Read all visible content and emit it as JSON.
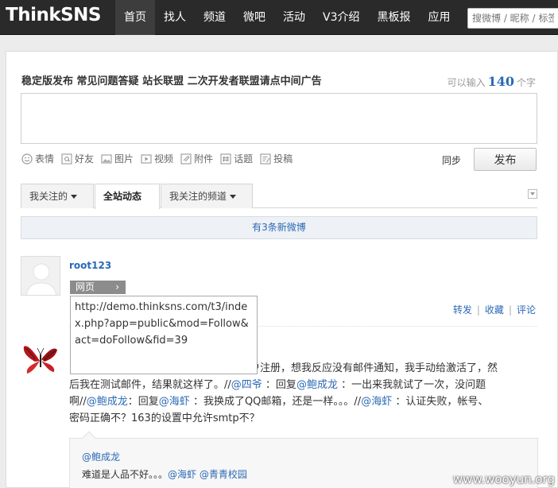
{
  "header": {
    "logo": "ThinkSNS",
    "nav": [
      {
        "label": "首页",
        "active": true
      },
      {
        "label": "找人"
      },
      {
        "label": "频道"
      },
      {
        "label": "微吧"
      },
      {
        "label": "活动"
      },
      {
        "label": "V3介绍"
      },
      {
        "label": "黑板报"
      },
      {
        "label": "应用"
      }
    ],
    "search_placeholder": "搜微博 / 昵称 / 标签"
  },
  "announce": {
    "links": [
      "稳定版发布",
      "常见问题答疑",
      "站长联盟",
      "二次开发者联盟请点中间广告"
    ]
  },
  "composer": {
    "counter_prefix": "可以输入",
    "counter_value": "140",
    "counter_suffix": "个字",
    "tools": [
      "表情",
      "好友",
      "图片",
      "视频",
      "附件",
      "话题",
      "投稿"
    ],
    "sync_label": "同步",
    "publish_label": "发布"
  },
  "tabs": [
    {
      "label": "我关注的",
      "dropdown": true
    },
    {
      "label": "全站动态",
      "active": true
    },
    {
      "label": "我关注的频道",
      "dropdown": true
    }
  ],
  "new_notice": "有3条新微博",
  "post1": {
    "username": "root123",
    "source_label": "网页",
    "source_arrow": "›",
    "url": "http://demo.thinksns.com/t3/index.php?app=public&mod=Follow&act=doFollow&fid=39",
    "actions": [
      "转发",
      "收藏",
      "评论"
    ]
  },
  "post2": {
    "line1": "户注册，想我反应没有邮件通知，我手动给激活了，然",
    "line2": "后我在测试邮件，结果就这样了。//",
    "mention_1": "@四爷",
    "text_2": "：回复",
    "mention_2": "@鲍成龙",
    "text_3": "：一出来我就试了一次，没问题",
    "text_4": "啊//",
    "mention_3": "@鲍成龙",
    "text_5": "：回复",
    "mention_4": "@海虾",
    "text_6": "：我换成了QQ邮箱，还是一样。。。//",
    "mention_5": "@海虾",
    "text_7": "：认证失败，帐号、",
    "text_8": "密码正确不？163的设置中允许smtp不？"
  },
  "quote": {
    "author": "@鲍成龙",
    "text": "难道是人品不好。。。",
    "mention_a": "@海虾",
    "mention_b": "@青青校园"
  },
  "watermark": "www.wooyun.org"
}
